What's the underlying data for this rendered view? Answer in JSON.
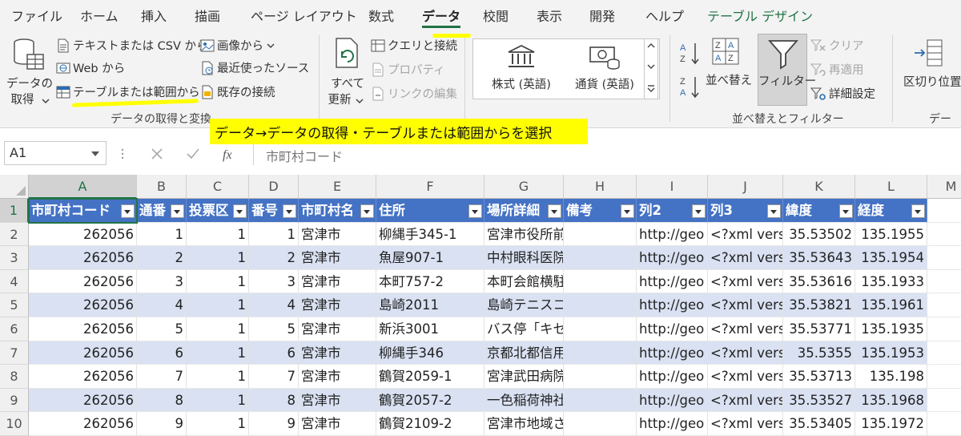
{
  "menu": {
    "tabs": [
      "ファイル",
      "ホーム",
      "挿入",
      "描画",
      "ページ レイアウト",
      "数式",
      "データ",
      "校閲",
      "表示",
      "開発",
      "ヘルプ",
      "テーブル デザイン"
    ],
    "active": "データ"
  },
  "ribbon": {
    "get_data": {
      "label1": "データの",
      "label2": "取得"
    },
    "from_text_csv": "テキストまたは CSV から",
    "from_web": "Web から",
    "from_table_range": "テーブルまたは範囲から",
    "from_picture": "画像から",
    "recent_sources": "最近使ったソース",
    "existing_connections": "既存の接続",
    "group_get_transform": "データの取得と変換",
    "refresh_all": {
      "label1": "すべて",
      "label2": "更新"
    },
    "queries_connections": "クエリと接続",
    "properties": "プロパティ",
    "edit_links": "リンクの編集",
    "stocks": "株式 (英語)",
    "currencies": "通貨 (英語)",
    "sort_button": "並べ替え",
    "filter_button": "フィルター",
    "clear": "クリア",
    "reapply": "再適用",
    "advanced": "詳細設定",
    "group_sort_filter": "並べ替えとフィルター",
    "text_to_columns": "区切り位置",
    "group_data_partial": "デー"
  },
  "formula_bar": {
    "name_box": "A1",
    "formula": "市町村コード"
  },
  "annotation": "データ→データの取得・テーブルまたは範囲からを選択",
  "sheet": {
    "columns": [
      "A",
      "B",
      "C",
      "D",
      "E",
      "F",
      "G",
      "H",
      "I",
      "J",
      "K",
      "L",
      "M"
    ],
    "rows": [
      "1",
      "2",
      "3",
      "4",
      "5",
      "6",
      "7",
      "8",
      "9",
      "10"
    ],
    "headers": [
      "市町村コード",
      "通番",
      "投票区",
      "番号",
      "市町村名",
      "住所",
      "場所詳細",
      "備考",
      "列2",
      "列3",
      "緯度",
      "経度"
    ],
    "data": [
      [
        "262056",
        "1",
        "1",
        "1",
        "宮津市",
        "柳縄手345-1",
        "宮津市役所前",
        "",
        "http://geo",
        "<?xml vers",
        "35.53502",
        "135.1955"
      ],
      [
        "262056",
        "2",
        "1",
        "2",
        "宮津市",
        "魚屋907-1",
        "中村眼科医院",
        "",
        "http://geo",
        "<?xml vers",
        "35.53643",
        "135.1954"
      ],
      [
        "262056",
        "3",
        "1",
        "3",
        "宮津市",
        "本町757-2",
        "本町会館横駐車場フェ",
        "",
        "http://geo",
        "<?xml vers",
        "35.53616",
        "135.1933"
      ],
      [
        "262056",
        "4",
        "1",
        "4",
        "宮津市",
        "島崎2011",
        "島崎テニスコートフェ",
        "",
        "http://geo",
        "<?xml vers",
        "35.53821",
        "135.1961"
      ],
      [
        "262056",
        "5",
        "1",
        "5",
        "宮津市",
        "新浜3001",
        "バス停「キセンバ港館",
        "",
        "http://geo",
        "<?xml vers",
        "35.53771",
        "135.1935"
      ],
      [
        "262056",
        "6",
        "1",
        "6",
        "宮津市",
        "柳縄手346",
        "京都北都信用金庫職員",
        "",
        "http://geo",
        "<?xml vers",
        "35.5355",
        "135.1953"
      ],
      [
        "262056",
        "7",
        "1",
        "7",
        "宮津市",
        "鶴賀2059-1",
        "宮津武田病院フェンス",
        "",
        "http://geo",
        "<?xml vers",
        "35.53713",
        "135.198"
      ],
      [
        "262056",
        "8",
        "1",
        "8",
        "宮津市",
        "鶴賀2057-2",
        "一色稲荷神社",
        "",
        "http://geo",
        "<?xml vers",
        "35.53527",
        "135.1968"
      ],
      [
        "262056",
        "9",
        "1",
        "9",
        "宮津市",
        "鶴賀2109-2",
        "宮津市地域ささえあい",
        "",
        "http://geo",
        "<?xml vers",
        "35.53405",
        "135.1972"
      ]
    ]
  },
  "colors": {
    "accent": "#217346",
    "table_header": "#4472c4",
    "band": "#d9e1f2",
    "highlight": "#ffff00"
  }
}
